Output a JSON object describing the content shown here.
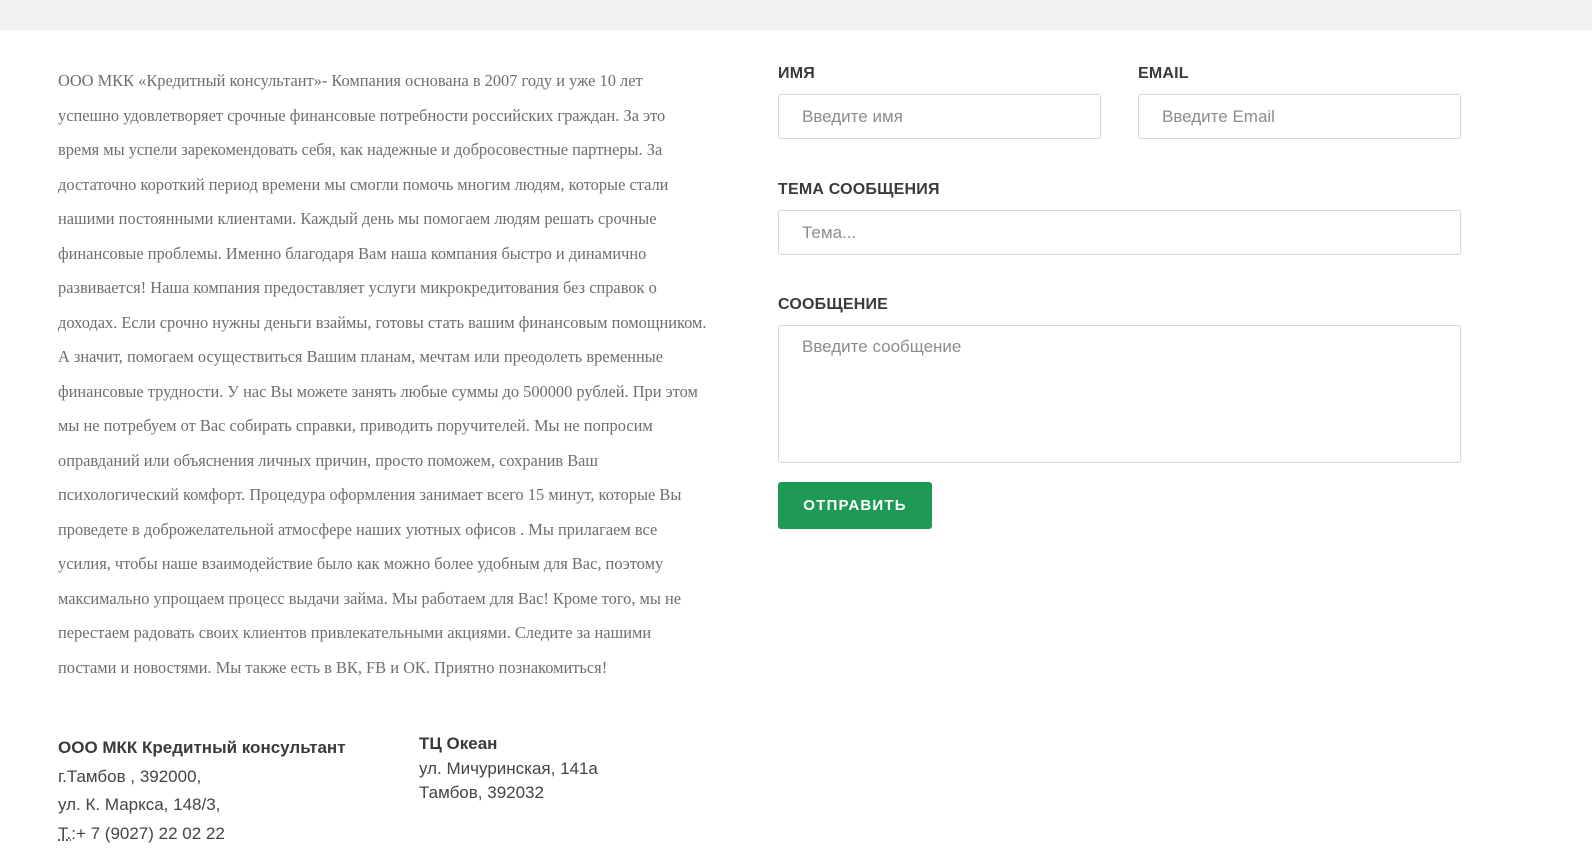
{
  "about": {
    "text": "ООО МКК «Кредитный консультант»- Компания основана в 2007 году и уже 10 лет\nуспешно удовлетворяет срочные финансовые потребности российских граждан. За это\nвремя мы успели зарекомендовать себя, как надежные и добросовестные партнеры. За\nдостаточно короткий период времени мы смогли помочь многим людям, которые стали\nнашими постоянными клиентами. Каждый день мы помогаем людям решать срочные\nфинансовые проблемы. Именно благодаря Вам наша компания быстро и динамично\nразвивается! Наша компания предоставляет услуги микрокредитования без справок о\nдоходах. Если срочно нужны деньги взаймы, готовы стать вашим финансовым помощником.\nА значит, помогаем осуществиться Вашим планам, мечтам или преодолеть временные\nфинансовые трудности. У нас Вы можете занять любые суммы до 500000 рублей. При этом\nмы не потребуем от Вас собирать справки, приводить поручителей. Мы не попросим\nоправданий или объяснения личных причин, просто поможем, сохранив Ваш\nпсихологический комфорт. Процедура оформления занимает всего 15 минут, которые Вы\nпроведете в доброжелательной атмосфере наших уютных офисов . Мы прилагаем все\nусилия, чтобы наше взаимодействие было как можно более удобным для Вас, поэтому\nмаксимально упрощаем процесс выдачи займа. Мы работаем для Вас! Кроме того, мы не\nперестаем радовать своих клиентов привлекательными акциями. Следите за нашими\nпостами и новостями. Мы также есть в ВК, FB и ОК. Приятно познакомиться!"
  },
  "form": {
    "name_label": "ИМЯ",
    "name_placeholder": "Введите имя",
    "email_label": "EMAIL",
    "email_placeholder": "Введите Email",
    "subject_label": "ТЕМА СООБЩЕНИЯ",
    "subject_placeholder": "Тема...",
    "message_label": "СООБЩЕНИЕ",
    "message_placeholder": "Введите сообщение",
    "submit_label": "ОТПРАВИТЬ"
  },
  "contacts": {
    "office1": {
      "title": "ООО МКК Кредитный консультант",
      "city": "г.Тамбов , 392000,",
      "street": "ул. К. Маркса, 148/3,",
      "phone_prefix": "Т.",
      "phone": ":+ 7 (9027) 22 02 22"
    },
    "office2": {
      "title": "ТЦ Океан",
      "street": "ул. Мичуринская, 141а",
      "city": "Тамбов, 392032"
    }
  },
  "colors": {
    "accent": "#1e9a55",
    "top_strip": "#f1f2f3"
  }
}
